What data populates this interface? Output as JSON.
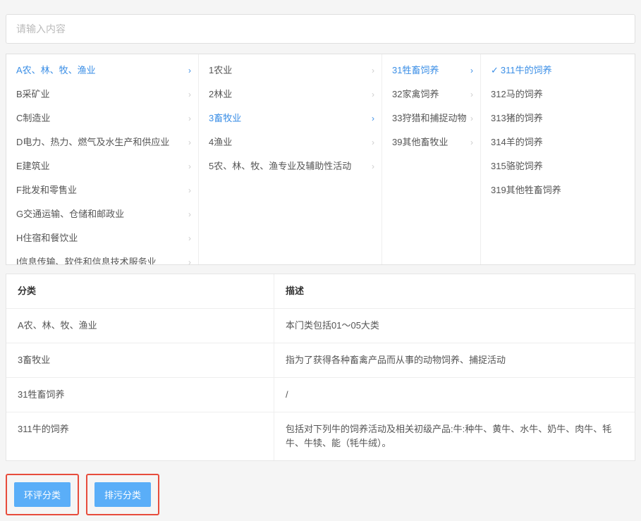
{
  "search": {
    "placeholder": "请输入内容"
  },
  "columns": {
    "c1": [
      {
        "label": "A农、林、牧、渔业",
        "active": true,
        "arrow": true
      },
      {
        "label": "B采矿业",
        "arrow": true
      },
      {
        "label": "C制造业",
        "arrow": true
      },
      {
        "label": "D电力、热力、燃气及水生产和供应业",
        "arrow": true
      },
      {
        "label": "E建筑业",
        "arrow": true
      },
      {
        "label": "F批发和零售业",
        "arrow": true
      },
      {
        "label": "G交通运输、仓储和邮政业",
        "arrow": true
      },
      {
        "label": "H住宿和餐饮业",
        "arrow": true
      },
      {
        "label": "I信息传输、软件和信息技术服务业",
        "arrow": true
      }
    ],
    "c2": [
      {
        "label": "1农业",
        "arrow": true
      },
      {
        "label": "2林业",
        "arrow": true
      },
      {
        "label": "3畜牧业",
        "active": true,
        "arrow": true
      },
      {
        "label": "4渔业",
        "arrow": true
      },
      {
        "label": "5农、林、牧、渔专业及辅助性活动",
        "arrow": true
      }
    ],
    "c3": [
      {
        "label": "31牲畜饲养",
        "active": true,
        "arrow": true
      },
      {
        "label": "32家禽饲养",
        "arrow": true
      },
      {
        "label": "33狩猎和捕捉动物",
        "arrow": true
      },
      {
        "label": "39其他畜牧业",
        "arrow": true
      }
    ],
    "c4": [
      {
        "label": "311牛的饲养",
        "selected": true
      },
      {
        "label": "312马的饲养"
      },
      {
        "label": "313猪的饲养"
      },
      {
        "label": "314羊的饲养"
      },
      {
        "label": "315骆驼饲养"
      },
      {
        "label": "319其他牲畜饲养"
      }
    ]
  },
  "table": {
    "header": {
      "left": "分类",
      "right": "描述"
    },
    "rows": [
      {
        "left": "A农、林、牧、渔业",
        "right": "本门类包括01～05大类"
      },
      {
        "left": "3畜牧业",
        "right": "指为了获得各种畜禽产品而从事的动物饲养、捕捉活动"
      },
      {
        "left": "31牲畜饲养",
        "right": "/"
      },
      {
        "left": "311牛的饲养",
        "right": "包括对下列牛的饲养活动及相关初级产品:牛:种牛、黄牛、水牛、奶牛、肉牛、牦牛、牛犊、能（牦牛绒）。"
      }
    ]
  },
  "buttons": {
    "env": "环评分类",
    "emit": "排污分类"
  }
}
